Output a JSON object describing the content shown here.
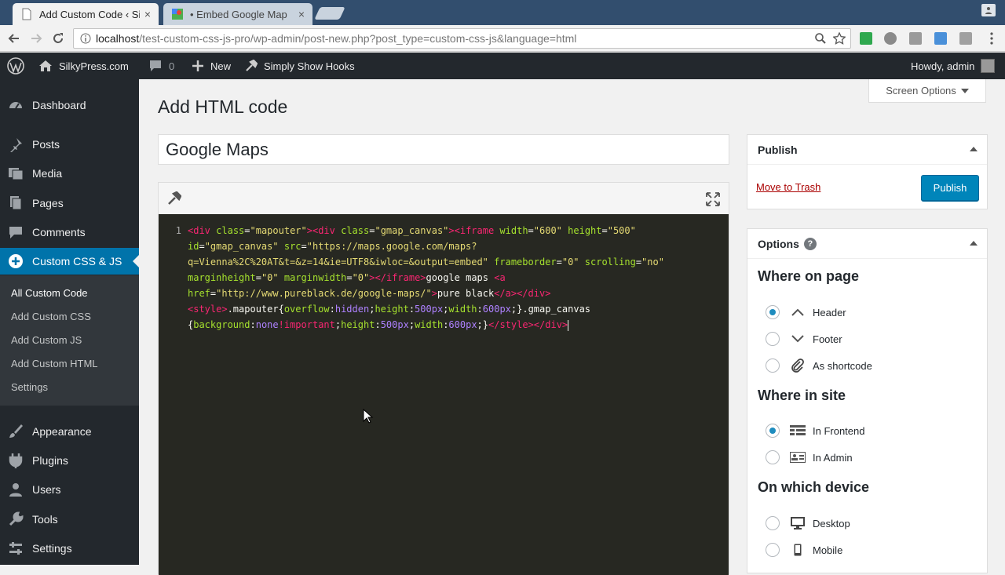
{
  "browser": {
    "tabs": [
      {
        "title": "Add Custom Code ‹ Si",
        "close": "×"
      },
      {
        "title": "• Embed Google Map",
        "close": "×"
      }
    ],
    "url_host": "localhost",
    "url_path": "/test-custom-css-js-pro/wp-admin/post-new.php?post_type=custom-css-js&language=html"
  },
  "adminbar": {
    "site": "SilkyPress.com",
    "comments_count": "0",
    "new": "New",
    "plugin": "Simply Show Hooks",
    "howdy": "Howdy, admin"
  },
  "sidebar": {
    "items": [
      {
        "label": "Dashboard",
        "icon": "dashboard-icon"
      },
      {
        "label": "Posts",
        "icon": "pin-icon"
      },
      {
        "label": "Media",
        "icon": "media-icon"
      },
      {
        "label": "Pages",
        "icon": "pages-icon"
      },
      {
        "label": "Comments",
        "icon": "comment-icon"
      },
      {
        "label": "Custom CSS & JS",
        "icon": "plus-circle-icon"
      },
      {
        "label": "Appearance",
        "icon": "brush-icon"
      },
      {
        "label": "Plugins",
        "icon": "plug-icon"
      },
      {
        "label": "Users",
        "icon": "user-icon"
      },
      {
        "label": "Tools",
        "icon": "wrench-icon"
      },
      {
        "label": "Settings",
        "icon": "settings-icon"
      }
    ],
    "submenu": [
      "All Custom Code",
      "Add Custom CSS",
      "Add Custom JS",
      "Add Custom HTML",
      "Settings"
    ]
  },
  "main": {
    "screen_options": "Screen Options",
    "page_title": "Add HTML code",
    "post_title": "Google Maps",
    "line_number": "1"
  },
  "publish": {
    "title": "Publish",
    "trash": "Move to Trash",
    "button": "Publish"
  },
  "options": {
    "title": "Options",
    "help": "?",
    "where_on_page": "Where on page",
    "header": "Header",
    "footer": "Footer",
    "shortcode": "As shortcode",
    "where_in_site": "Where in site",
    "frontend": "In Frontend",
    "admin": "In Admin",
    "device": "On which device",
    "desktop": "Desktop",
    "mobile": "Mobile"
  }
}
